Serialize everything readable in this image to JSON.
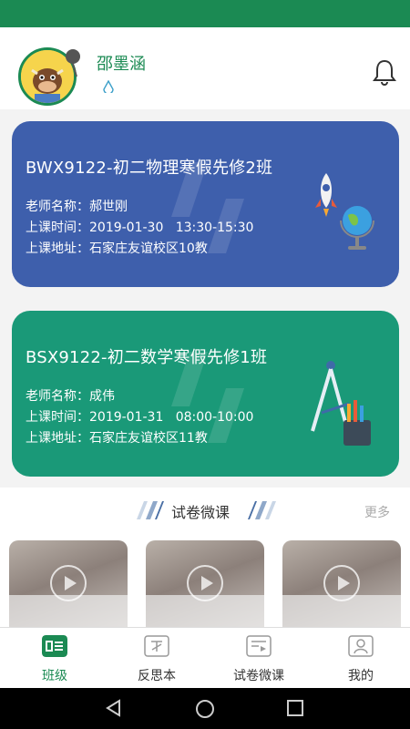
{
  "header": {
    "username": "邵墨涵"
  },
  "icons": {
    "bell": "bell-icon",
    "gender": "female-gender-icon"
  },
  "classes": [
    {
      "title": "BWX9122-初二物理寒假先修2班",
      "teacher_label": "老师名称：",
      "teacher": "郝世刚",
      "time_label": "上课时间：",
      "time": "2019-01-30   13:30-15:30",
      "address_label": "上课地址：",
      "address": "石家庄友谊校区10教",
      "color": "#3e5fac"
    },
    {
      "title": "BSX9122-初二数学寒假先修1班",
      "teacher_label": "老师名称：",
      "teacher": "成伟",
      "time_label": "上课时间：",
      "time": "2019-01-31   08:00-10:00",
      "address_label": "上课地址：",
      "address": "石家庄友谊校区11教",
      "color": "#1a9978"
    }
  ],
  "section": {
    "title": "试卷微课",
    "more": "更多"
  },
  "tabs": [
    {
      "label": "班级",
      "active": true
    },
    {
      "label": "反思本",
      "active": false
    },
    {
      "label": "试卷微课",
      "active": false
    },
    {
      "label": "我的",
      "active": false
    }
  ],
  "colors": {
    "brand": "#1b8a53",
    "card_blue": "#3e5fac",
    "card_green": "#1a9978"
  }
}
